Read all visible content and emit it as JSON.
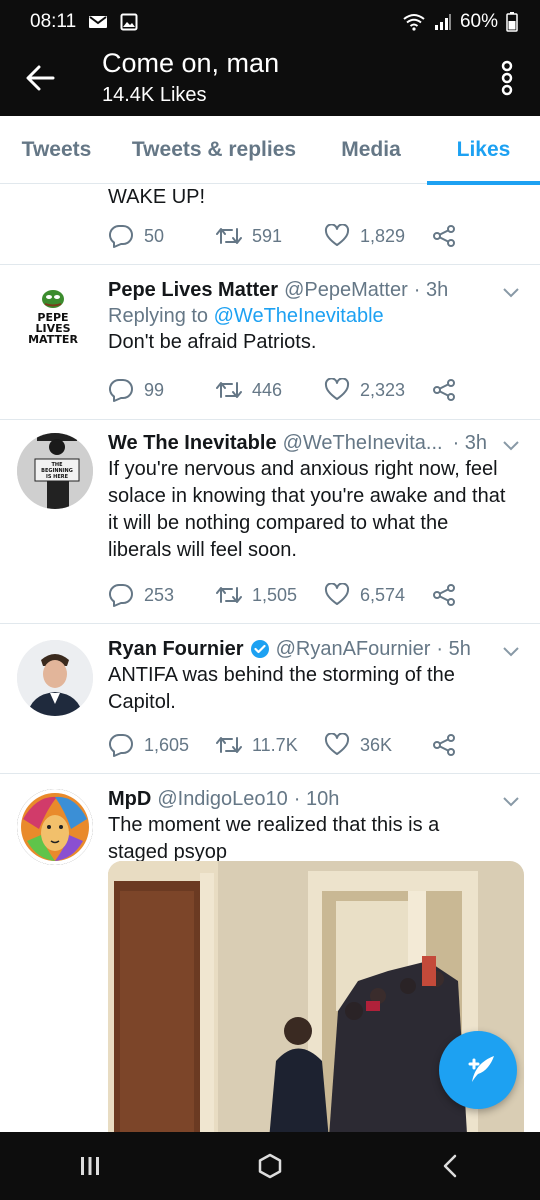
{
  "status_bar": {
    "time": "08:11",
    "battery": "60%",
    "icons": [
      "mail-icon",
      "image-icon",
      "wifi-icon",
      "signal-icon",
      "battery-icon"
    ]
  },
  "header": {
    "title": "Come on, man",
    "subtitle": "14.4K Likes",
    "back_icon": "arrow-left-icon",
    "more_icon": "more-vertical-icon"
  },
  "tabs": [
    {
      "label": "Tweets",
      "active": false
    },
    {
      "label": "Tweets & replies",
      "active": false
    },
    {
      "label": "Media",
      "active": false
    },
    {
      "label": "Likes",
      "active": true
    }
  ],
  "tweets": [
    {
      "text": "WAKE UP!",
      "replies": "50",
      "retweets": "591",
      "likes": "1,829"
    },
    {
      "author": "Pepe Lives Matter",
      "handle": "@PepeMatter",
      "time": "· 3h",
      "replying_prefix": "Replying to ",
      "replying_to": "@WeTheInevitable",
      "text": "Don't be afraid Patriots.",
      "replies": "99",
      "retweets": "446",
      "likes": "2,323",
      "avatar_text": [
        "PEPE",
        "LIVES",
        "MATTER"
      ]
    },
    {
      "author": "We The Inevitable",
      "handle": "@WeTheInevita...",
      "time": "· 3h",
      "text_lines": [
        "If you're nervous and anxious right now, feel",
        "solace in knowing that you're awake and that",
        "it will be nothing compared to what the",
        "liberals will feel soon."
      ],
      "replies": "253",
      "retweets": "1,505",
      "likes": "6,574",
      "avatar_sign": [
        "THE",
        "BEGINNING",
        "IS HERE"
      ]
    },
    {
      "author": "Ryan Fournier",
      "verified": true,
      "handle": "@RyanAFournier",
      "time": "· 5h",
      "text_lines": [
        "ANTIFA was behind the storming of the",
        "Capitol."
      ],
      "replies": "1,605",
      "retweets": "11.7K",
      "likes": "36K"
    },
    {
      "author": "MpD",
      "handle": "@IndigoLeo10",
      "time": "· 10h",
      "text_lines": [
        "The moment we realized that this is a",
        "staged psyop"
      ]
    }
  ],
  "fab": {
    "icon": "compose-tweet-icon"
  },
  "nav": {
    "icons": [
      "recents-icon",
      "home-icon",
      "back-icon"
    ]
  },
  "colors": {
    "accent": "#1da1f2",
    "text": "#14171a",
    "secondary": "#657786",
    "bar": "#0d0d0d"
  }
}
